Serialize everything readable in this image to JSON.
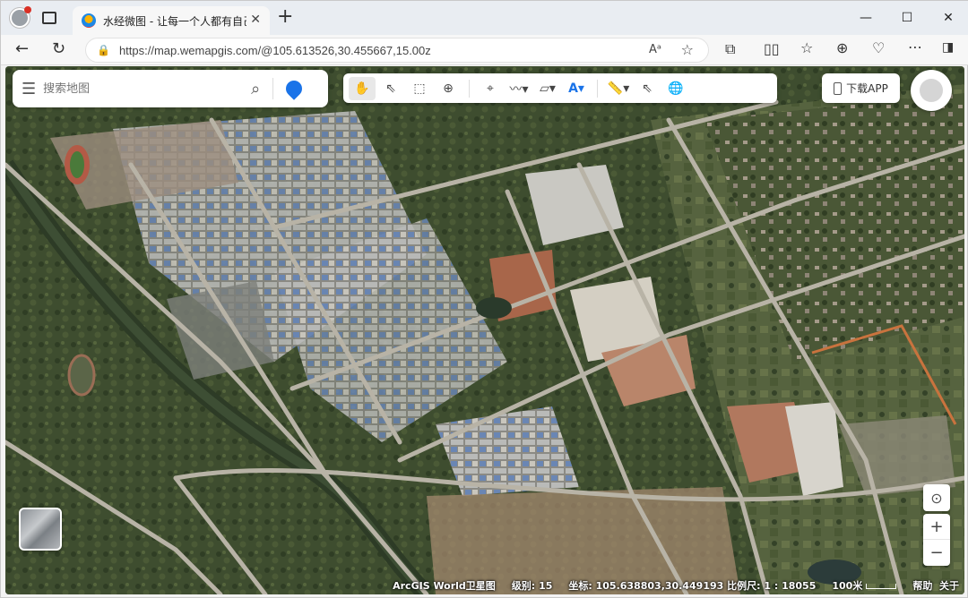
{
  "browser": {
    "tab_title": "水经微图 - 让每一个人都有自己的",
    "url": "https://map.wemapgis.com/@105.613526,30.455667,15.00z",
    "new_tab_symbol": "+"
  },
  "map": {
    "search_placeholder": "搜索地图",
    "download_app_label": "下载APP",
    "status": {
      "basemap": "ArcGIS World卫星图",
      "level_label": "级别:",
      "level_value": "15",
      "coord_label": "坐标:",
      "coord_value": "105.638803,30.449193",
      "scale_label": "比例尺:",
      "scale_value": "1 : 18055",
      "scalebar_label": "100米",
      "help_label": "帮助",
      "about_label": "关于"
    }
  },
  "colors": {
    "accent": "#1a73e8",
    "land_dark": "#3b4a2c",
    "land_mid": "#5b6b43",
    "road": "#b8b3a6",
    "bare_soil": "#b47a5a"
  }
}
